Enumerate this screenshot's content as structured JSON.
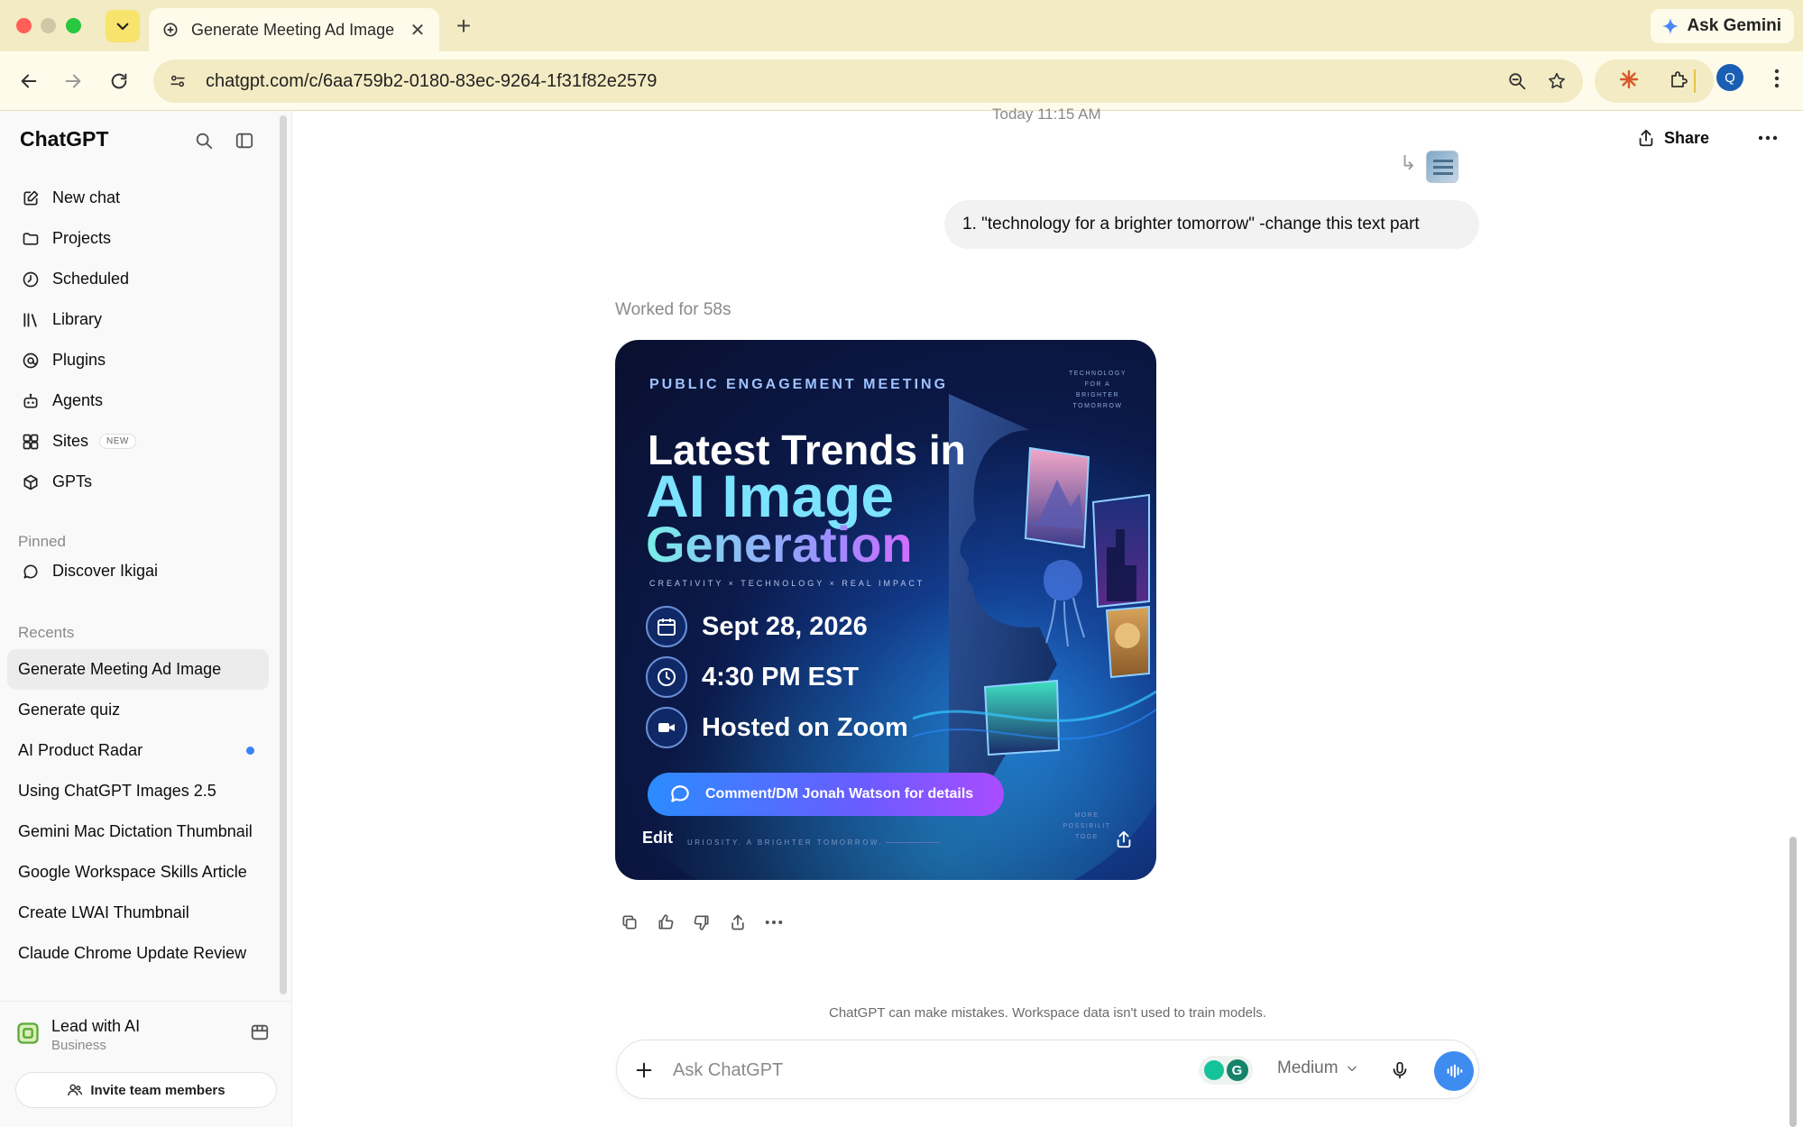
{
  "browser": {
    "tab_title": "Generate Meeting Ad Image",
    "url": "chatgpt.com/c/6aa759b2-0180-83ec-9264-1f31f82e2579",
    "ask_gemini": "Ask Gemini",
    "profile_initial": "Q"
  },
  "sidebar": {
    "brand": "ChatGPT",
    "nav": [
      {
        "label": "New chat",
        "icon": "new-chat-icon"
      },
      {
        "label": "Projects",
        "icon": "folder-icon"
      },
      {
        "label": "Scheduled",
        "icon": "clock-icon"
      },
      {
        "label": "Library",
        "icon": "library-icon"
      },
      {
        "label": "Plugins",
        "icon": "plugins-icon"
      },
      {
        "label": "Agents",
        "icon": "robot-icon"
      },
      {
        "label": "Sites",
        "icon": "sites-icon",
        "badge": "NEW"
      },
      {
        "label": "GPTs",
        "icon": "cube-icon"
      }
    ],
    "pinned_heading": "Pinned",
    "pinned": [
      {
        "label": "Discover Ikigai"
      }
    ],
    "recents_heading": "Recents",
    "recents": [
      {
        "label": "Generate Meeting Ad Image"
      },
      {
        "label": "Generate quiz"
      },
      {
        "label": "AI Product Radar"
      },
      {
        "label": "Using ChatGPT Images 2.5"
      },
      {
        "label": "Gemini Mac Dictation Thumbnail"
      },
      {
        "label": "Google Workspace Skills Article"
      },
      {
        "label": "Create LWAI Thumbnail"
      },
      {
        "label": "Claude Chrome Update Review"
      }
    ],
    "workspace": {
      "name": "Lead with AI",
      "plan": "Business"
    },
    "invite_label": "Invite team members"
  },
  "chat": {
    "timestamp": "Today 11:15 AM",
    "share_label": "Share",
    "user_message": "1. \"technology for a brighter tomorrow\" -change this text part",
    "worked_label": "Worked for 58s",
    "ad": {
      "eyebrow": "PUBLIC ENGAGEMENT MEETING",
      "corner_text": "TECHNOLOGY FOR A BRIGHTER TOMORROW",
      "headline_1": "Latest Trends in",
      "headline_2": "AI Image",
      "headline_3": "Generation",
      "tagline": "CREATIVITY × TECHNOLOGY × REAL IMPACT",
      "date": "Sept 28, 2026",
      "time": "4:30 PM EST",
      "platform": "Hosted on Zoom",
      "cta": "Comment/DM Jonah Watson for details",
      "footer_text": "URIOSITY. A BRIGHTER TOMORROW.",
      "more_text": "MORE POSSIBILIT TOGE",
      "edit_label": "Edit"
    },
    "disclaimer": "ChatGPT can make mistakes. Workspace data isn't used to train models.",
    "composer": {
      "placeholder": "Ask ChatGPT",
      "model": "Medium"
    }
  }
}
